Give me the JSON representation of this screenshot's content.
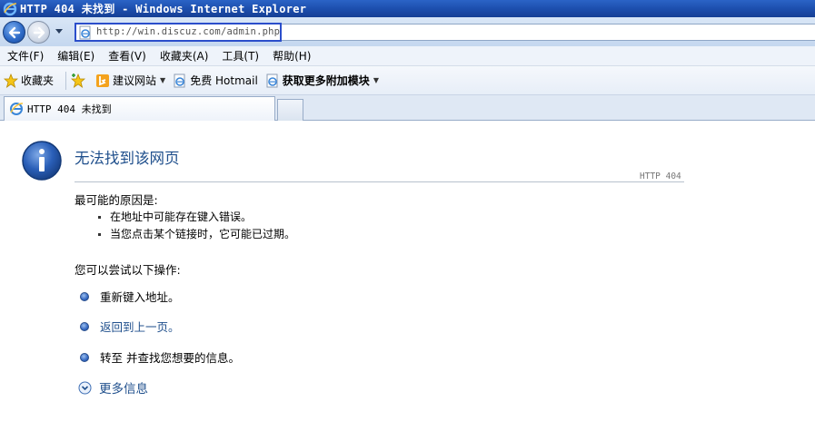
{
  "window": {
    "title": "HTTP 404 未找到 - Windows Internet Explorer"
  },
  "address": {
    "url": "http://win.discuz.com/admin.php"
  },
  "menu": {
    "items": [
      "文件(F)",
      "编辑(E)",
      "查看(V)",
      "收藏夹(A)",
      "工具(T)",
      "帮助(H)"
    ]
  },
  "favorites": {
    "favorites_label": "收藏夹",
    "suggested_sites": "建议网站",
    "free_hotmail": "免费 Hotmail",
    "get_addons": "获取更多附加模块"
  },
  "tabs": [
    {
      "label": "HTTP 404 未找到"
    }
  ],
  "page": {
    "heading": "无法找到该网页",
    "code": "HTTP 404",
    "reasons_title": "最可能的原因是:",
    "reasons": [
      "在地址中可能存在键入错误。",
      "当您点击某个链接时，它可能已过期。"
    ],
    "try_title": "您可以尝试以下操作:",
    "actions": [
      {
        "text": "重新键入地址。"
      },
      {
        "text": "返回到上一页。"
      },
      {
        "text": "转至  并查找您想要的信息。"
      }
    ],
    "more_info": "更多信息"
  },
  "colors": {
    "link": "#1f4f8c",
    "titlebar": "#1d4fae",
    "address_focus": "#2b4ecb"
  },
  "icons": [
    "ie-icon",
    "back-arrow-icon",
    "forward-arrow-icon",
    "star-icon",
    "bing-icon",
    "info-icon",
    "bullet-icon",
    "expand-icon"
  ]
}
